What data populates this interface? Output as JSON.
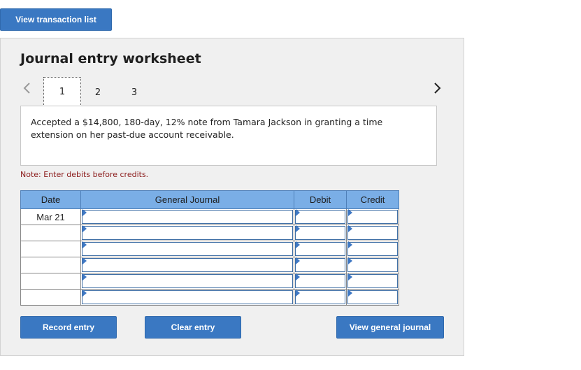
{
  "top": {
    "view_transaction_list": "View transaction list"
  },
  "worksheet": {
    "title": "Journal entry worksheet",
    "tabs": [
      "1",
      "2",
      "3"
    ],
    "description": "Accepted a $14,800, 180-day, 12% note from Tamara Jackson in granting a time extension on her past-due account receivable.",
    "note": "Note: Enter debits before credits."
  },
  "table": {
    "headers": {
      "date": "Date",
      "general_journal": "General Journal",
      "debit": "Debit",
      "credit": "Credit"
    },
    "rows": [
      {
        "date": "Mar 21"
      },
      {
        "date": ""
      },
      {
        "date": ""
      },
      {
        "date": ""
      },
      {
        "date": ""
      },
      {
        "date": ""
      }
    ]
  },
  "buttons": {
    "record_entry": "Record entry",
    "clear_entry": "Clear entry",
    "view_general_journal": "View general journal"
  },
  "colors": {
    "button_blue": "#3a78c2",
    "header_blue": "#7aaee6",
    "note_red": "#8b1a1a"
  }
}
